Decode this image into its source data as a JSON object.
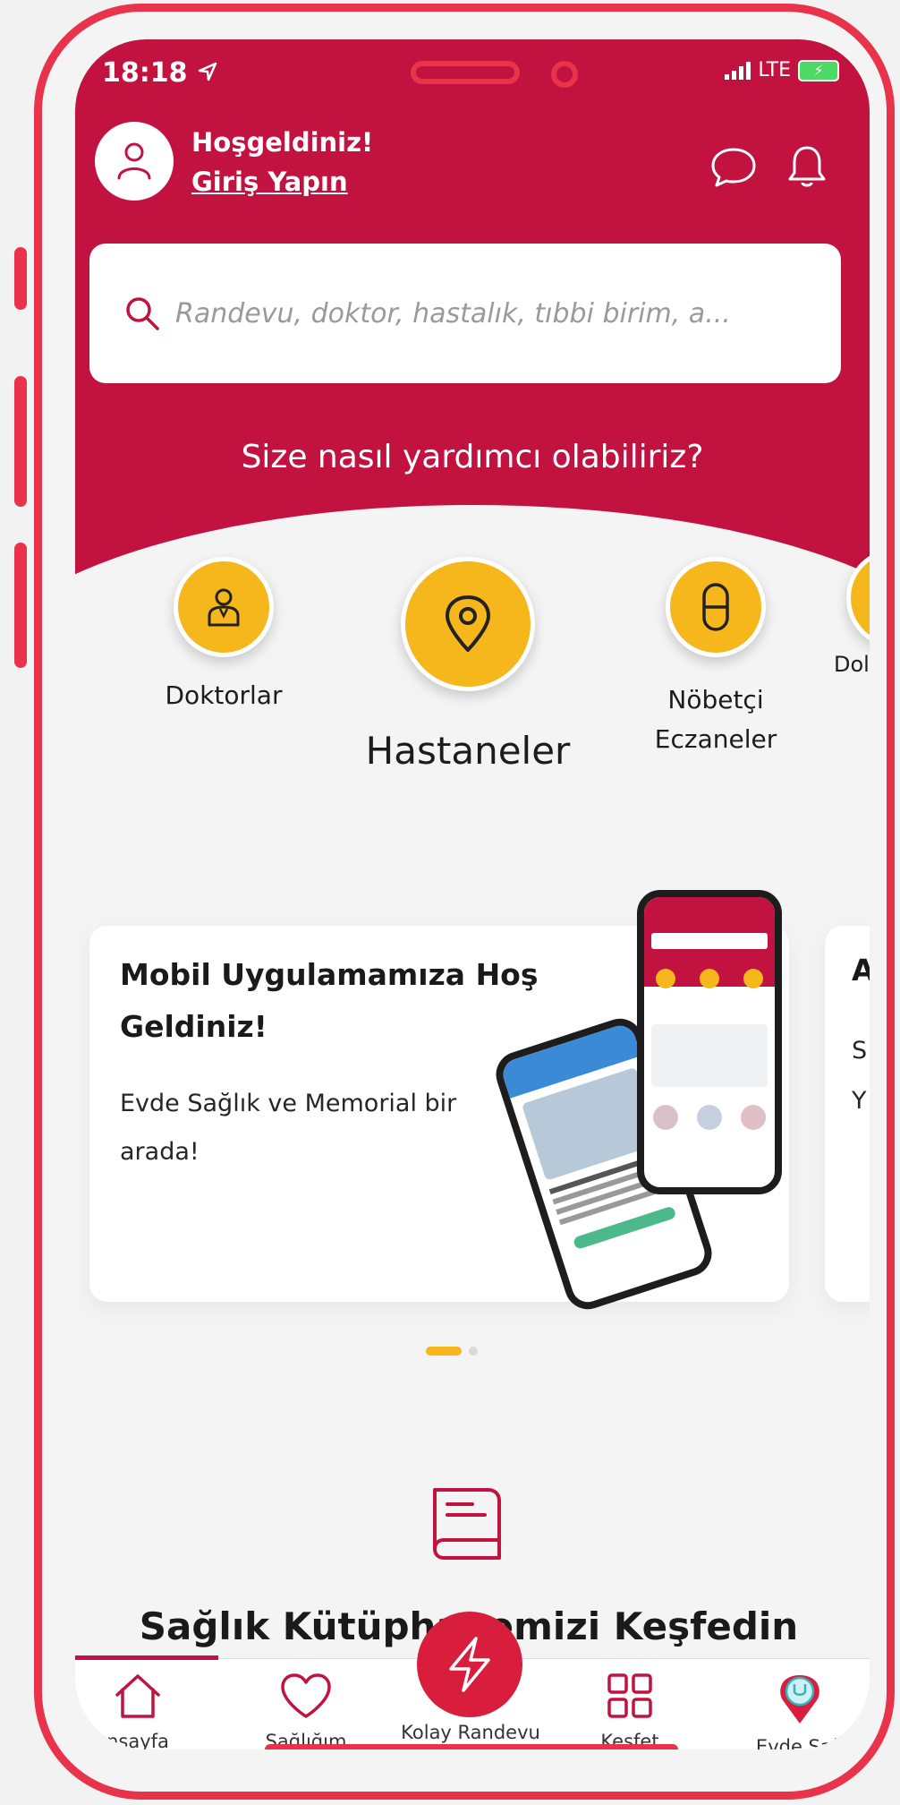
{
  "status_bar": {
    "time": "18:18",
    "network": "LTE"
  },
  "header": {
    "welcome": "Hoşgeldiniz!",
    "login_link": "Giriş Yapın"
  },
  "search": {
    "placeholder": "Randevu, doktor, hastalık, tıbbi birim, a..."
  },
  "help_title": "Size nasıl yardımcı olabiliriz?",
  "categories": [
    {
      "label": "Doktorlar",
      "icon": "doctor-icon"
    },
    {
      "label": "Hastaneler",
      "icon": "location-pin-icon"
    },
    {
      "label": "Nöbetçi Eczaneler",
      "icon": "pill-icon"
    },
    {
      "label": "Dol",
      "icon": "category-icon"
    }
  ],
  "cards": [
    {
      "title": "Mobil Uygulamamıza Hoş Geldiniz!",
      "text": "Evde Sağlık ve Memorial bir arada!"
    },
    {
      "title": "A",
      "text": "S Y"
    }
  ],
  "library_title": "Sağlık Kütüphanemizi Keşfedin",
  "bottom_nav": [
    {
      "label": "nsayfa",
      "icon": "home-icon"
    },
    {
      "label": "Sağlığım",
      "icon": "heart-icon"
    },
    {
      "label": "Kolay Randevu",
      "icon": "lightning-icon"
    },
    {
      "label": "Keşfet",
      "icon": "grid-icon"
    },
    {
      "label": "Evde Sağ",
      "icon": "stethoscope-pin-icon"
    }
  ],
  "colors": {
    "brand_red": "#c2123f",
    "accent_yellow": "#f5b71b",
    "frame": "#e8334a"
  }
}
